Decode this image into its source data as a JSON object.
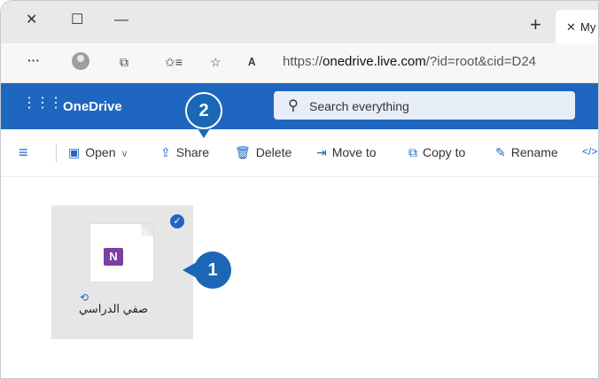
{
  "window": {
    "close_glyph": "✕",
    "restore_glyph": "☐",
    "minimize_glyph": "—"
  },
  "tabs": {
    "new_tab_glyph": "+",
    "close_glyph": "✕",
    "active_title": "My"
  },
  "addressbar": {
    "more_glyph": "···",
    "collections_glyph": "⧉",
    "favorites_glyph": "✩≡",
    "add_favorite_glyph": "☆",
    "read_aloud_glyph": "𝐀",
    "url_prefix": "https://",
    "url_host": "onedrive.live.com",
    "url_rest": "/?id=root&cid=D24"
  },
  "onedrive": {
    "brand": "OneDrive",
    "search_placeholder": "Search everything",
    "commands": {
      "open": "Open",
      "share": "Share",
      "delete": "Delete",
      "move_to": "Move to",
      "copy_to": "Copy to",
      "rename": "Rename",
      "embed_glyph": "</>"
    }
  },
  "file": {
    "name": "صفي الدراسي",
    "type_letter": "N",
    "app": "OneNote"
  },
  "badges": {
    "step1": "1",
    "step2": "2"
  },
  "colors": {
    "accent": "#1f66c1",
    "badge": "#1a67b5",
    "onenote": "#7b3fa4"
  }
}
